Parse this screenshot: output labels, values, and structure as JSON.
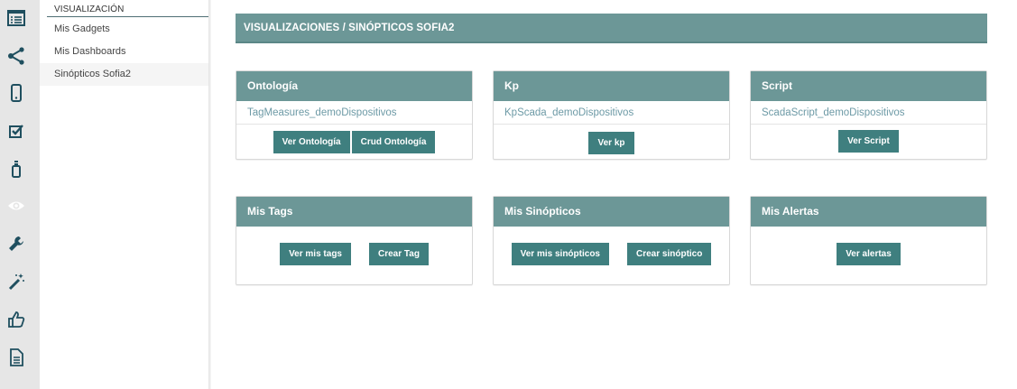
{
  "colors": {
    "accent": "#6c9797",
    "button": "#3f7f7f",
    "link": "#6d9aa6",
    "rail": "#e6e6e6"
  },
  "rail": {
    "icons": [
      "list-icon",
      "share-icon",
      "mobile-icon",
      "checkbox-icon",
      "device-icon",
      "eye-icon",
      "wrench-icon",
      "magic-wand-icon",
      "thumbs-up-icon",
      "document-icon"
    ]
  },
  "submenu": {
    "header": "VISUALIZACIÓN",
    "items": [
      {
        "label": "Mis Gadgets"
      },
      {
        "label": "Mis Dashboards"
      },
      {
        "label": "Sinópticos Sofia2"
      }
    ]
  },
  "main": {
    "title": "VISUALIZACIONES / SINÓPTICOS SOFIA2",
    "panels": [
      {
        "title": "Ontología",
        "link": "TagMeasures_demoDispositivos",
        "buttons": [
          "Ver Ontología",
          "Crud Ontología"
        ]
      },
      {
        "title": "Kp",
        "link": "KpScada_demoDispositivos",
        "buttons": [
          "Ver kp"
        ]
      },
      {
        "title": "Script",
        "link": "ScadaScript_demoDispositivos",
        "buttons": [
          "Ver Script"
        ]
      },
      {
        "title": "Mis Tags",
        "buttons": [
          "Ver mis tags",
          "Crear Tag"
        ]
      },
      {
        "title": "Mis Sinópticos",
        "buttons": [
          "Ver mis sinópticos",
          "Crear sinóptico"
        ]
      },
      {
        "title": "Mis Alertas",
        "buttons": [
          "Ver alertas"
        ]
      }
    ]
  }
}
